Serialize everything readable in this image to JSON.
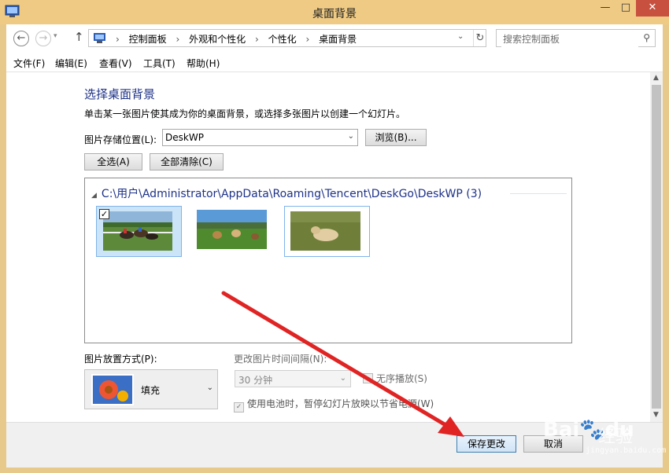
{
  "window": {
    "title": "桌面背景",
    "minimize": "—",
    "maximize": "□",
    "close": "✕"
  },
  "address": {
    "crumbs": [
      "控制面板",
      "外观和个性化",
      "个性化",
      "桌面背景"
    ],
    "separator": "›"
  },
  "search": {
    "placeholder": "搜索控制面板"
  },
  "menu": [
    "文件(F)",
    "编辑(E)",
    "查看(V)",
    "工具(T)",
    "帮助(H)"
  ],
  "main": {
    "heading": "选择桌面背景",
    "description": "单击某一张图片使其成为你的桌面背景，或选择多张图片以创建一个幻灯片。",
    "location_label": "图片存储位置(L):",
    "location_value": "DeskWP",
    "browse_label": "浏览(B)...",
    "select_all_label": "全选(A)",
    "clear_all_label": "全部清除(C)",
    "group_header": "C:\\用户\\Administrator\\AppData\\Roaming\\Tencent\\DeskGo\\DeskWP (3)",
    "tiles": [
      {
        "name": "horse-racing",
        "selected": true,
        "checked": true
      },
      {
        "name": "horses-field",
        "selected": false,
        "checked": false
      },
      {
        "name": "horse-lying",
        "selected": true,
        "checked": false
      }
    ],
    "position_label": "图片放置方式(P):",
    "position_value": "填充",
    "interval_label": "更改图片时间间隔(N):",
    "interval_value": "30 分钟",
    "shuffle_label": "无序播放(S)",
    "battery_label": "使用电池时，暂停幻灯片放映以节省电源(W)"
  },
  "footer": {
    "save_label": "保存更改",
    "cancel_label": "取消"
  },
  "watermark": {
    "brand": "Bai",
    "brand_b": "du",
    "suffix": "经验",
    "url": "jingyan.baidu.com"
  },
  "colors": {
    "accent": "#1e3287",
    "arrow": "#e02424",
    "title_bar": "#efca84"
  }
}
